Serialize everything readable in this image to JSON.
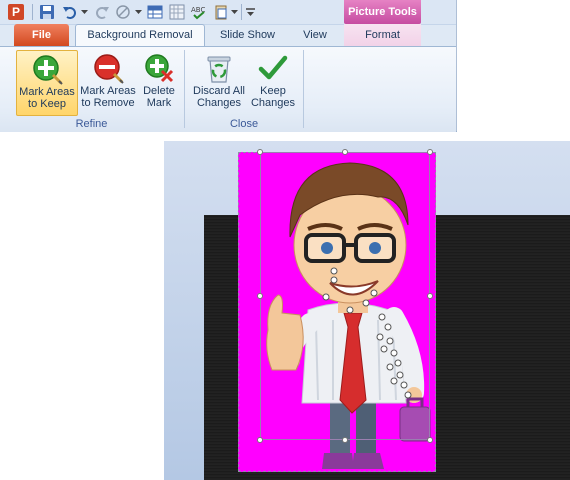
{
  "contextual_tab": {
    "label": "Picture Tools"
  },
  "tabs": {
    "file": "File",
    "background_removal": "Background Removal",
    "slide_show": "Slide Show",
    "view": "View",
    "format": "Format"
  },
  "groups": {
    "refine": {
      "label": "Refine",
      "mark_keep": "Mark Areas\nto Keep",
      "mark_remove": "Mark Areas\nto Remove",
      "delete_mark": "Delete\nMark"
    },
    "close": {
      "label": "Close",
      "discard": "Discard All\nChanges",
      "keep": "Keep\nChanges"
    }
  },
  "colors": {
    "removal_overlay": "#ff00ff",
    "file_tab": "#d2491f",
    "contextual_tab": "#c64ca1",
    "keep_button_active": "#ffd56a"
  }
}
